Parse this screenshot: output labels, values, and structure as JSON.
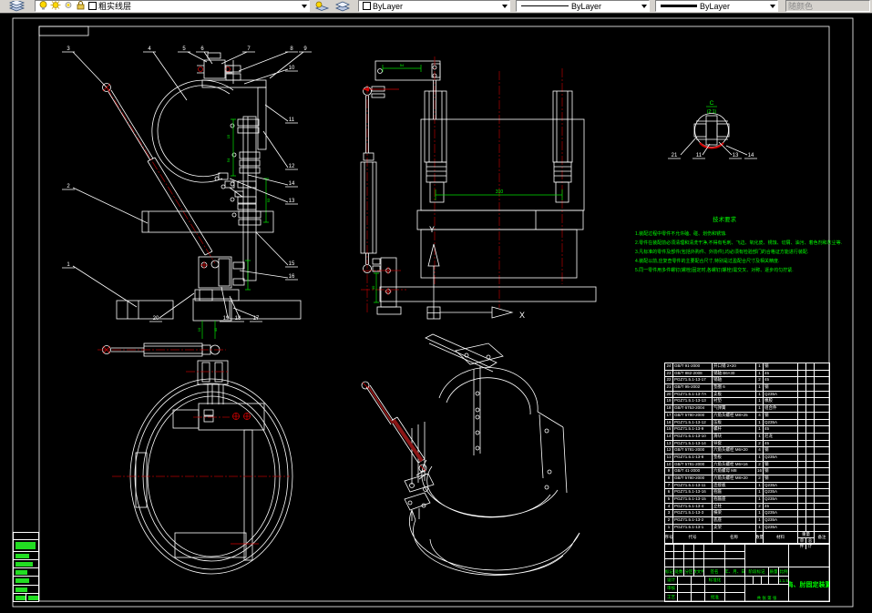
{
  "toolbar": {
    "layer_name": "粗实线层",
    "color": "ByLayer",
    "linetype": "ByLayer",
    "lineweight": "ByLayer",
    "plot_style": "随颜色"
  },
  "callouts": {
    "n1": "1",
    "n2": "2",
    "n3": "3",
    "n4": "4",
    "n5": "5",
    "n6": "6",
    "n7": "7",
    "n8": "8",
    "n9": "9",
    "n10": "10",
    "n11": "11",
    "n12": "12",
    "n13": "13",
    "n14": "14",
    "n15": "15",
    "n16": "16",
    "n17": "17",
    "n18": "18",
    "n19": "19",
    "n20": "20"
  },
  "detail": {
    "label": "C",
    "scale": "(2:1)",
    "c1": "21",
    "c2": "11",
    "c3": "13",
    "c4": "14"
  },
  "dims": {
    "d15": "15",
    "d54": "54",
    "d93": "93",
    "d10": "10",
    "d45": "45",
    "d310": "310",
    "d54b": "54",
    "d40": "40"
  },
  "ucs": {
    "x": "X",
    "y": "Y"
  },
  "notes": {
    "title": "技术要求",
    "l1": "1.装配过程中零件不允许磕、碰、划伤和锈蚀.",
    "l2": "2.零件在装配前必须清理和清洗干净,不得有毛刺、飞边、氧化皮、锈蚀、切屑、油污、着色剂和灰尘等.",
    "l3": "3.凡标准的零件及部件(包括外购件、外协件),均必须有检验部门的合格证方能进行装配.",
    "l4": "4.装配以前,应复查零件的主要配合尺寸,特别是过盈配合尺寸及相关精度.",
    "l5": "5.同一零件用多件螺钉(螺栓)固定时,各螺钉(螺栓)需交叉、对称、逐步均匀拧紧."
  },
  "bom": {
    "h_no": "序号",
    "h_code": "代号",
    "h_name": "名称",
    "h_qty": "数量",
    "h_mat": "材料",
    "h_weight": "重量",
    "h_unit": "单件",
    "h_total": "总计",
    "h_note": "备注",
    "rows": [
      [
        "24",
        "GB/T 91-2000",
        "开口销 2×20",
        "1",
        "钢"
      ],
      [
        "23",
        "GB/T 882-2008",
        "销轴 B6×30",
        "1",
        "45"
      ],
      [
        "22",
        "PGZ71.5.1-13-17",
        "销轴",
        "2",
        "45"
      ],
      [
        "21",
        "GB/T 95-2002",
        "垫圈 6",
        "1",
        "钢"
      ],
      [
        "20",
        "PGZ71.5.1-13-7A",
        "支板",
        "1",
        "Q235A"
      ],
      [
        "19",
        "PGZ71.5.1-13-13",
        "衬垫",
        "1",
        "橡胶"
      ],
      [
        "18",
        "GB/T 6753-2004",
        "气弹簧",
        "1",
        "组合件"
      ],
      [
        "17",
        "GB/T 5780-2000",
        "六角头螺栓 M8×25",
        "4",
        "钢"
      ],
      [
        "16",
        "PGZ71.5.1-13-12",
        "压板",
        "1",
        "Q235A"
      ],
      [
        "15",
        "PGZ71.5.1-13-9",
        "螺杆",
        "1",
        "45"
      ],
      [
        "14",
        "PGZ71.5.1-13-10",
        "滑块",
        "1",
        "尼龙"
      ],
      [
        "13",
        "PGZ71.5.1-13-14",
        "导套",
        "2",
        "45"
      ],
      [
        "12",
        "GB/T 5781-2000",
        "六角头螺栓 M6×20",
        "4",
        "钢"
      ],
      [
        "11",
        "PGZ71.5.1-13-8",
        "垫板",
        "1",
        "Q235A"
      ],
      [
        "10",
        "GB/T 5781-2000",
        "六角头螺栓 M6×16",
        "2",
        "钢"
      ],
      [
        "9",
        "GB/T 41-2000",
        "六角螺母 M8",
        "16",
        "钢"
      ],
      [
        "8",
        "GB/T 5780-2000",
        "六角头螺栓 M8×20",
        "2",
        "钢"
      ],
      [
        "7",
        "PGZ71.5.1-13-11",
        "连接板",
        "1",
        "Q235A"
      ],
      [
        "6",
        "PGZ71.5.1-13-16",
        "抱箍",
        "1",
        "Q235A"
      ],
      [
        "5",
        "PGZ71.5.1-13-15",
        "抱箍座",
        "1",
        "Q235A"
      ],
      [
        "4",
        "PGZ71.5.1-13-4",
        "立柱",
        "2",
        "45"
      ],
      [
        "3",
        "PGZ71.5.1-13-3",
        "横梁",
        "1",
        "Q235A"
      ],
      [
        "2",
        "PGZ71.5.1-13-2",
        "底座",
        "1",
        "Q235A"
      ],
      [
        "1",
        "PGZ71.5.1-13-1",
        "支架",
        "1",
        "Q235A"
      ]
    ]
  },
  "title_block": {
    "r1": "标记",
    "r2": "处数",
    "r3": "分区",
    "r4": "更改文件号",
    "r5": "签名",
    "r6": "年、月、日",
    "design": "设计",
    "audit": "审核",
    "craft": "工艺",
    "standard": "标准化",
    "approve": "批准",
    "stage": "阶段标记",
    "mass": "质量",
    "scale_label": "比例",
    "scale": "1:1.5",
    "sheets": "共 张 第 张",
    "title": "肩、肘固定装置"
  }
}
